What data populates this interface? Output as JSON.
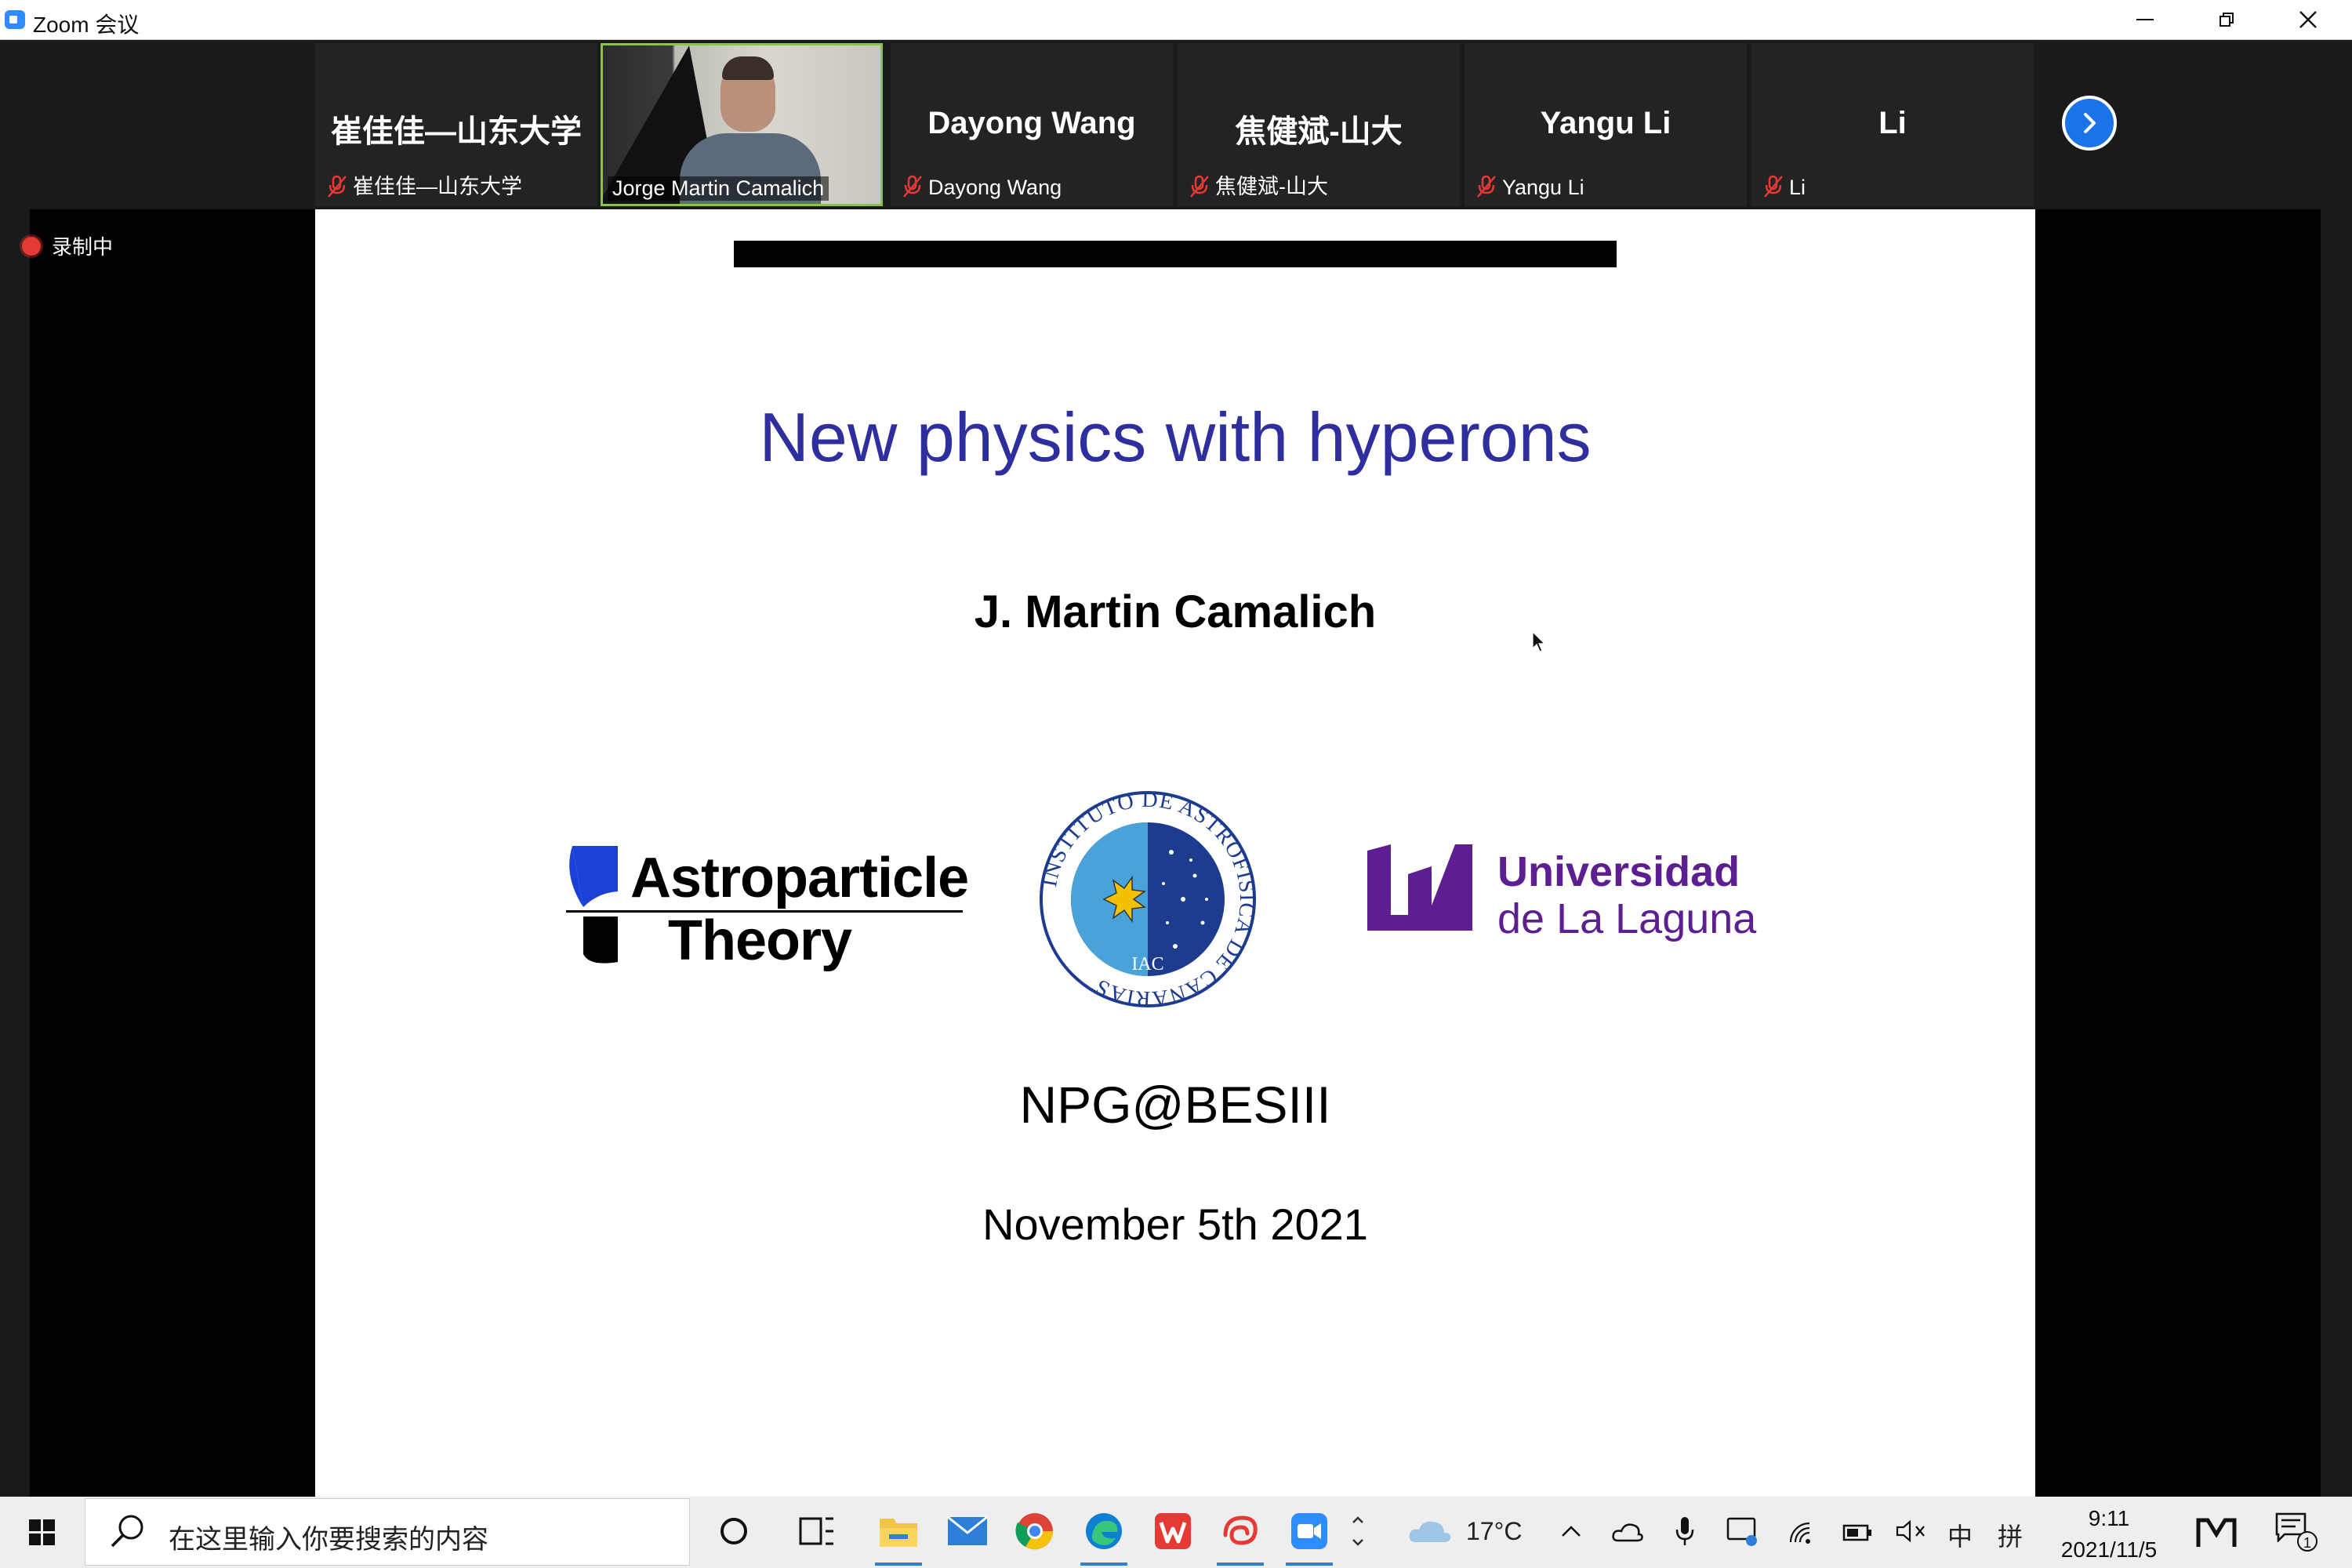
{
  "window": {
    "title": "Zoom 会议"
  },
  "participants": [
    {
      "big_name": "崔佳佳—山东大学",
      "small_name": "崔佳佳—山东大学",
      "video": false,
      "muted": true
    },
    {
      "big_name": "",
      "small_name": "Jorge Martin Camalich",
      "video": true,
      "muted": false
    },
    {
      "big_name": "Dayong Wang",
      "small_name": "Dayong Wang",
      "video": false,
      "muted": true
    },
    {
      "big_name": "焦健斌-山大",
      "small_name": "焦健斌-山大",
      "video": false,
      "muted": true
    },
    {
      "big_name": "Yangu Li",
      "small_name": "Yangu Li",
      "video": false,
      "muted": true
    },
    {
      "big_name": "Li",
      "small_name": "Li",
      "video": false,
      "muted": true
    }
  ],
  "recording": {
    "label": "录制中"
  },
  "slide": {
    "title": "New physics with hyperons",
    "author": "J. Martin Camalich",
    "logos": {
      "astroparticle_line1": "Astroparticle",
      "astroparticle_line2": "Theory",
      "iac_ring_text": "INSTITUTO DE ASTROFISICA DE CANARIAS",
      "iac_short": "IAC",
      "ull_line1": "Universidad",
      "ull_line2": "de La Laguna"
    },
    "venue": "NPG@BESIII",
    "date": "November 5th 2021"
  },
  "taskbar": {
    "search_placeholder": "在这里输入你要搜索的内容",
    "weather": "17°C",
    "ime_lang": "中",
    "ime_mode": "拼",
    "time": "9:11",
    "date": "2021/11/5",
    "notification_count": "1"
  },
  "colors": {
    "slide_title": "#2e2e9e",
    "ull_purple": "#5c1e91",
    "zoom_blue": "#2d8cff",
    "speaker_border": "#8bc34a"
  }
}
